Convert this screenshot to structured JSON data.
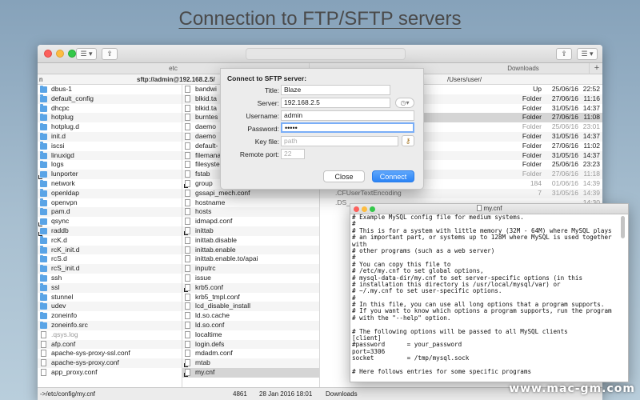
{
  "hero": {
    "title": "Connection to FTP/SFTP servers"
  },
  "window": {
    "tabs": {
      "left": "etc",
      "right": "Downloads",
      "add": "+"
    },
    "path": {
      "marker": "n",
      "left": "sftp://admin@192.168.2.5/",
      "right": "/Users/user/"
    },
    "left_files": [
      {
        "name": "dbus-1",
        "icon": "folder"
      },
      {
        "name": "default_config",
        "icon": "folder"
      },
      {
        "name": "dhcpc",
        "icon": "folder"
      },
      {
        "name": "hotplug",
        "icon": "folder"
      },
      {
        "name": "hotplug.d",
        "icon": "folder"
      },
      {
        "name": "init.d",
        "icon": "folder"
      },
      {
        "name": "iscsi",
        "icon": "folder"
      },
      {
        "name": "linuxigd",
        "icon": "folder"
      },
      {
        "name": "logs",
        "icon": "folder"
      },
      {
        "name": "lunporter",
        "icon": "link-folder"
      },
      {
        "name": "network",
        "icon": "folder"
      },
      {
        "name": "openldap",
        "icon": "folder"
      },
      {
        "name": "openvpn",
        "icon": "folder"
      },
      {
        "name": "pam.d",
        "icon": "folder"
      },
      {
        "name": "qsync",
        "icon": "link-folder"
      },
      {
        "name": "raddb",
        "icon": "link-folder"
      },
      {
        "name": "rcK.d",
        "icon": "folder"
      },
      {
        "name": "rcK_init.d",
        "icon": "folder"
      },
      {
        "name": "rcS.d",
        "icon": "folder"
      },
      {
        "name": "rcS_init.d",
        "icon": "folder"
      },
      {
        "name": "ssh",
        "icon": "folder"
      },
      {
        "name": "ssl",
        "icon": "folder"
      },
      {
        "name": "stunnel",
        "icon": "folder"
      },
      {
        "name": "udev",
        "icon": "folder"
      },
      {
        "name": "zoneinfo",
        "icon": "folder"
      },
      {
        "name": "zoneinfo.src",
        "icon": "folder"
      },
      {
        "name": ".qsys.log",
        "icon": "file",
        "dim": true
      },
      {
        "name": "afp.conf",
        "icon": "file"
      },
      {
        "name": "apache-sys-proxy-ssl.conf",
        "icon": "file"
      },
      {
        "name": "apache-sys-proxy.conf",
        "icon": "file"
      },
      {
        "name": "app_proxy.conf",
        "icon": "file"
      }
    ],
    "mid_files": [
      {
        "name": "bandwi",
        "icon": "file"
      },
      {
        "name": "blkid.ta",
        "icon": "file"
      },
      {
        "name": "blkid.ta",
        "icon": "file"
      },
      {
        "name": "burntes",
        "icon": "file"
      },
      {
        "name": "daemo",
        "icon": "file"
      },
      {
        "name": "daemo",
        "icon": "file"
      },
      {
        "name": "default-",
        "icon": "file"
      },
      {
        "name": "filemana",
        "icon": "file"
      },
      {
        "name": "filesyste",
        "icon": "file"
      },
      {
        "name": "fstab",
        "icon": "file"
      },
      {
        "name": "group",
        "icon": "link"
      },
      {
        "name": "gssapi_mech.conf",
        "icon": "file"
      },
      {
        "name": "hostname",
        "icon": "file"
      },
      {
        "name": "hosts",
        "icon": "file"
      },
      {
        "name": "idmapd.conf",
        "icon": "file"
      },
      {
        "name": "inittab",
        "icon": "link"
      },
      {
        "name": "inittab.disable",
        "icon": "file"
      },
      {
        "name": "inittab.enable",
        "icon": "file"
      },
      {
        "name": "inittab.enable.to/apai",
        "icon": "file"
      },
      {
        "name": "inputrc",
        "icon": "file"
      },
      {
        "name": "issue",
        "icon": "file"
      },
      {
        "name": "krb5.conf",
        "icon": "link"
      },
      {
        "name": "krb5_tmpl.conf",
        "icon": "file"
      },
      {
        "name": "lcd_disable_install",
        "icon": "file"
      },
      {
        "name": "ld.so.cache",
        "icon": "file"
      },
      {
        "name": "ld.so.conf",
        "icon": "file"
      },
      {
        "name": "localtime",
        "icon": "file"
      },
      {
        "name": "login.defs",
        "icon": "file"
      },
      {
        "name": "mdadm.conf",
        "icon": "file"
      },
      {
        "name": "mtab",
        "icon": "link"
      },
      {
        "name": "my.cnf",
        "icon": "link",
        "selected": true
      }
    ],
    "right_extra": [
      ".CFUserTextEncoding",
      ".DS_"
    ],
    "right_rows": [
      {
        "kind": "Up",
        "date": "25/06/16",
        "time": "22:52"
      },
      {
        "kind": "Folder",
        "date": "27/06/16",
        "time": "11:16"
      },
      {
        "kind": "Folder",
        "date": "31/05/16",
        "time": "14:37"
      },
      {
        "kind": "Folder",
        "date": "27/06/16",
        "time": "11:08",
        "selected": true
      },
      {
        "kind": "Folder",
        "date": "25/06/16",
        "time": "23:01",
        "dim": true
      },
      {
        "kind": "Folder",
        "date": "31/05/16",
        "time": "14:37"
      },
      {
        "kind": "Folder",
        "date": "27/06/16",
        "time": "11:02"
      },
      {
        "kind": "Folder",
        "date": "31/05/16",
        "time": "14:37"
      },
      {
        "kind": "Folder",
        "date": "25/06/16",
        "time": "23:23"
      },
      {
        "kind": "Folder",
        "date": "27/06/16",
        "time": "11:18",
        "dim": true
      },
      {
        "kind": "184",
        "date": "01/06/16",
        "time": "14:39",
        "dim": true
      },
      {
        "kind": "7",
        "date": "31/05/16",
        "time": "14:39",
        "dim": true
      },
      {
        "kind": "",
        "date": "",
        "time": "14:30",
        "dim": true
      }
    ],
    "status": {
      "path": "->/etc/config/my.cnf",
      "size": "4861",
      "date": "28 Jan 2016 18:01",
      "right": "Downloads"
    }
  },
  "dialog": {
    "title": "Connect to SFTP server:",
    "fields": {
      "title_label": "Title:",
      "title_value": "Blaze",
      "server_label": "Server:",
      "server_value": "192.168.2.5",
      "username_label": "Username:",
      "username_value": "admin",
      "password_label": "Password:",
      "password_value": "•••••",
      "keyfile_label": "Key file:",
      "keyfile_placeholder": "path",
      "port_label": "Remote port:",
      "port_placeholder": "22"
    },
    "close": "Close",
    "connect": "Connect"
  },
  "editor": {
    "title": "my.cnf",
    "lines": [
      "# Example MySQL config file for medium systems.",
      "#",
      "# This is for a system with little memory (32M - 64M) where MySQL plays",
      "# an important part, or systems up to 128M where MySQL is used together",
      "with",
      "# other programs (such as a web server)",
      "#",
      "# You can copy this file to",
      "# /etc/my.cnf to set global options,",
      "# mysql-data-dir/my.cnf to set server-specific options (in this",
      "# installation this directory is /usr/local/mysql/var) or",
      "# ~/.my.cnf to set user-specific options.",
      "#",
      "# In this file, you can use all long options that a program supports.",
      "# If you want to know which options a program supports, run the program",
      "# with the \"--help\" option.",
      "",
      "# The following options will be passed to all MySQL clients",
      "[client]",
      "#password      = your_password",
      "port=3306",
      "socket         = /tmp/mysql.sock",
      "",
      "# Here follows entries for some specific programs"
    ]
  },
  "watermark": "www.mac-gm.com",
  "colors": {
    "selection": "#d5d5d5",
    "accent": "#3b8ff5",
    "folder": "#5aa4e6"
  }
}
